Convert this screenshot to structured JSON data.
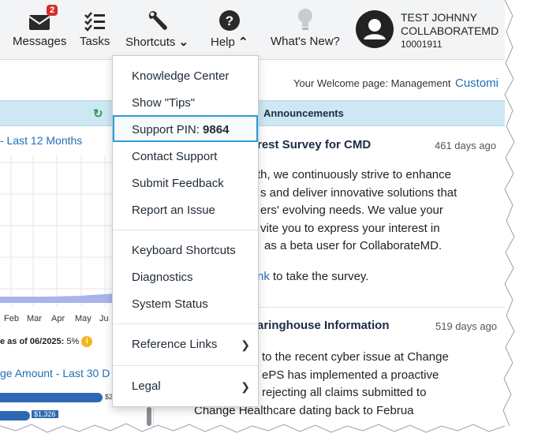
{
  "topbar": {
    "messages": {
      "label": "Messages",
      "badge": "2"
    },
    "tasks": {
      "label": "Tasks"
    },
    "shortcuts": {
      "label": "Shortcuts"
    },
    "help": {
      "label": "Help"
    },
    "whats_new": {
      "label": "What's New?"
    },
    "user": {
      "name_line1": "TEST JOHNNY",
      "name_line2": "COLLABORATEMD",
      "id": "10001911"
    }
  },
  "header": {
    "welcome_text": "Your Welcome page: Management",
    "customize_link": "Customi"
  },
  "announcements": {
    "title": "Announcements"
  },
  "left_panel": {
    "chart1_title": "- Last 12 Months",
    "months": [
      "Feb",
      "Mar",
      "Apr",
      "May",
      "Ju"
    ],
    "as_of_label": "e as of 06/2025:",
    "as_of_value": "5%",
    "info_icon": "i",
    "chart2_title": "ge Amount - Last 30 D",
    "bar1_label": "$2",
    "bar2_label": "$1,326"
  },
  "posts": [
    {
      "title": "rest Survey for CMD",
      "age": "461 days ago",
      "lines": [
        "th, we continuously strive to enhance",
        "s and deliver innovative solutions that",
        "ers' evolving needs. We value your",
        "vite you to express your interest in",
        "as a beta user for CollaborateMD."
      ],
      "link_text": "nk",
      "link_tail": "to take the survey."
    },
    {
      "title": "aringhouse Information",
      "age": "519 days ago",
      "lines": [
        "to the recent cyber issue at Change",
        "ePS has implemented a proactive",
        "rejecting all claims submitted to",
        "Change Healthcare dating back to Februa"
      ]
    }
  ],
  "help_menu": {
    "items": [
      {
        "label": "Knowledge Center"
      },
      {
        "label": "Show \"Tips\""
      },
      {
        "label": "Support PIN: ",
        "pin": "9864"
      },
      {
        "label": "Contact Support"
      },
      {
        "label": "Submit Feedback"
      },
      {
        "label": "Report an Issue"
      },
      {
        "label": "Keyboard Shortcuts"
      },
      {
        "label": "Diagnostics"
      },
      {
        "label": "System Status"
      },
      {
        "label": "Reference Links"
      },
      {
        "label": "Legal"
      }
    ]
  },
  "colors": {
    "accent_blue": "#1f6fb5",
    "band": "#cde7f3",
    "badge_red": "#d62b2b",
    "highlight_border": "#2e9ad6"
  }
}
